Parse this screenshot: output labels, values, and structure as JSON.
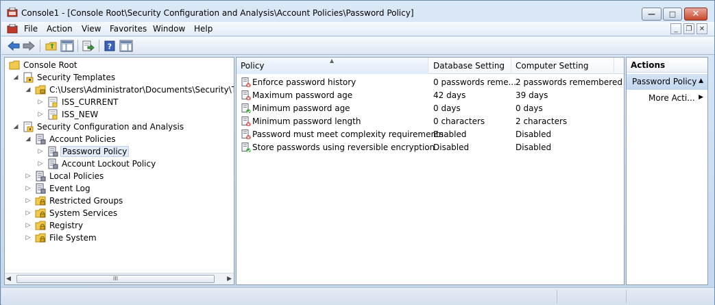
{
  "window": {
    "title": "Console1 - [Console Root\\Security Configuration and Analysis\\Account Policies\\Password Policy]",
    "minimize_icon": "minimize-icon",
    "maximize_icon": "restore-icon",
    "close_icon": "close-icon"
  },
  "menu": {
    "items": [
      "File",
      "Action",
      "View",
      "Favorites",
      "Window",
      "Help"
    ]
  },
  "toolbar": {
    "buttons": [
      "back-arrow-icon",
      "forward-arrow-icon",
      "up-folder-icon",
      "show-hide-tree-icon",
      "export-list-icon",
      "help-icon",
      "show-hide-action-pane-icon"
    ]
  },
  "tree": {
    "items": [
      {
        "label": "Console Root",
        "icon": "folder-icon",
        "expander": ""
      },
      {
        "label": "Security Templates",
        "icon": "security-templates-icon",
        "expander": "expanded"
      },
      {
        "label": "C:\\Users\\Administrator\\Documents\\Security\\Templ",
        "icon": "template-folder-icon",
        "expander": "expanded"
      },
      {
        "label": "ISS_CURRENT",
        "icon": "template-icon",
        "expander": "collapsed"
      },
      {
        "label": "ISS_NEW",
        "icon": "template-icon",
        "expander": "collapsed"
      },
      {
        "label": "Security Configuration and Analysis",
        "icon": "security-analysis-icon",
        "expander": "expanded"
      },
      {
        "label": "Account Policies",
        "icon": "policy-icon",
        "expander": "expanded"
      },
      {
        "label": "Password Policy",
        "icon": "policy-icon",
        "expander": "collapsed",
        "selected": true
      },
      {
        "label": "Account Lockout Policy",
        "icon": "policy-icon",
        "expander": "collapsed"
      },
      {
        "label": "Local Policies",
        "icon": "policy-icon",
        "expander": "collapsed"
      },
      {
        "label": "Event Log",
        "icon": "policy-icon",
        "expander": "collapsed"
      },
      {
        "label": "Restricted Groups",
        "icon": "locked-folder-icon",
        "expander": "collapsed"
      },
      {
        "label": "System Services",
        "icon": "locked-folder-icon",
        "expander": "collapsed"
      },
      {
        "label": "Registry",
        "icon": "locked-folder-icon",
        "expander": "collapsed"
      },
      {
        "label": "File System",
        "icon": "locked-folder-icon",
        "expander": "collapsed"
      }
    ],
    "scroll_thumb_grip": "III"
  },
  "list": {
    "columns": [
      "Policy",
      "Database Setting",
      "Computer Setting"
    ],
    "rows": [
      {
        "policy": "Enforce password history",
        "database": "0 passwords reme...",
        "computer": "2 passwords remembered",
        "status": "mismatch"
      },
      {
        "policy": "Maximum password age",
        "database": "42 days",
        "computer": "39 days",
        "status": "mismatch"
      },
      {
        "policy": "Minimum password age",
        "database": "0 days",
        "computer": "0 days",
        "status": "match"
      },
      {
        "policy": "Minimum password length",
        "database": "0 characters",
        "computer": "2 characters",
        "status": "mismatch"
      },
      {
        "policy": "Password must meet complexity requirements",
        "database": "Enabled",
        "computer": "Disabled",
        "status": "mismatch"
      },
      {
        "policy": "Store passwords using reversible encryption",
        "database": "Disabled",
        "computer": "Disabled",
        "status": "match"
      }
    ]
  },
  "actions": {
    "title": "Actions",
    "section": "Password Policy",
    "more": "More Acti..."
  },
  "colors": {
    "mismatch": "#d9342b",
    "match": "#3ea53e",
    "folder": "#f2c94c",
    "selection": "#e2ecf8"
  }
}
